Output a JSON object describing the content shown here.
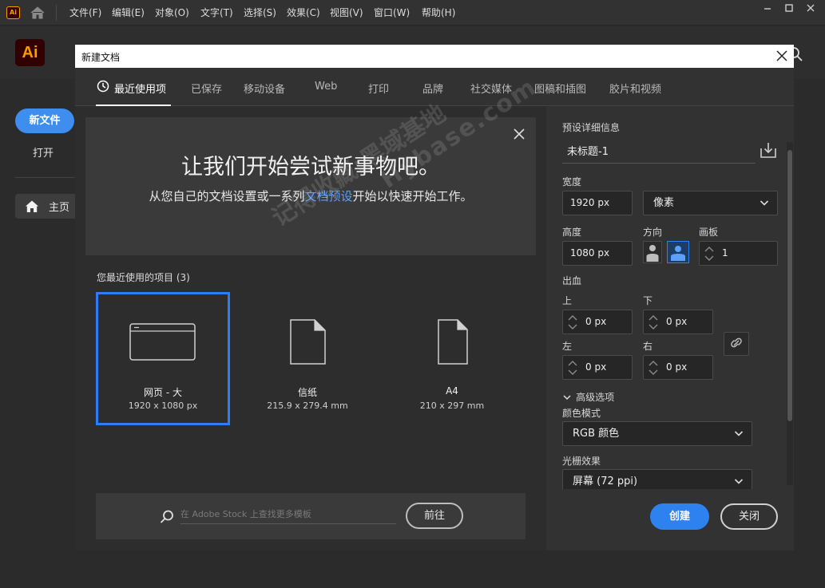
{
  "app": {
    "badge": "Ai",
    "logo": "Ai"
  },
  "menu": [
    "文件(F)",
    "编辑(E)",
    "对象(O)",
    "文字(T)",
    "选择(S)",
    "效果(C)",
    "视图(V)",
    "窗口(W)",
    "帮助(H)"
  ],
  "left_nav": {
    "new_file": "新文件",
    "open": "打开",
    "home": "主页"
  },
  "dialog": {
    "title": "新建文档",
    "tabs": [
      "最近使用项",
      "已保存",
      "移动设备",
      "Web",
      "打印",
      "品牌",
      "社交媒体",
      "图稿和插图",
      "胶片和视频"
    ],
    "hero": {
      "title": "让我们开始尝试新事物吧。",
      "sub_before": "从您自己的文档设置或一系列",
      "sub_link": "文档预设",
      "sub_after": "开始以快速开始工作。"
    },
    "recent": {
      "title": "您最近使用的项目 (3)",
      "items": [
        {
          "name": "网页 - 大",
          "size": "1920 x 1080 px"
        },
        {
          "name": "信纸",
          "size": "215.9 x 279.4 mm"
        },
        {
          "name": "A4",
          "size": "210 x 297 mm"
        }
      ]
    },
    "search": {
      "placeholder": "在 Adobe Stock 上查找更多模板",
      "go": "前往"
    },
    "preset": {
      "section_title": "预设详细信息",
      "doc_name": "未标题-1",
      "width_label": "宽度",
      "width": "1920 px",
      "unit": "像素",
      "height_label": "高度",
      "height": "1080 px",
      "orientation_label": "方向",
      "artboards_label": "画板",
      "artboards": "1",
      "bleed_label": "出血",
      "top_label": "上",
      "top": "0 px",
      "bottom_label": "下",
      "bottom": "0 px",
      "left_label": "左",
      "left": "0 px",
      "right_label": "右",
      "right": "0 px",
      "advanced": "高级选项",
      "color_mode_label": "颜色模式",
      "color_mode": "RGB 颜色",
      "raster_label": "光栅效果",
      "raster": "屏幕 (72 ppi)"
    },
    "buttons": {
      "create": "创建",
      "close": "关闭"
    }
  },
  "watermark": {
    "line1": "记得收藏:黑域基地",
    "line2": "Hybase.com"
  },
  "colors": {
    "accent": "#2e82f0",
    "brand_orange": "#ff9a00",
    "brand_bg": "#330000"
  }
}
